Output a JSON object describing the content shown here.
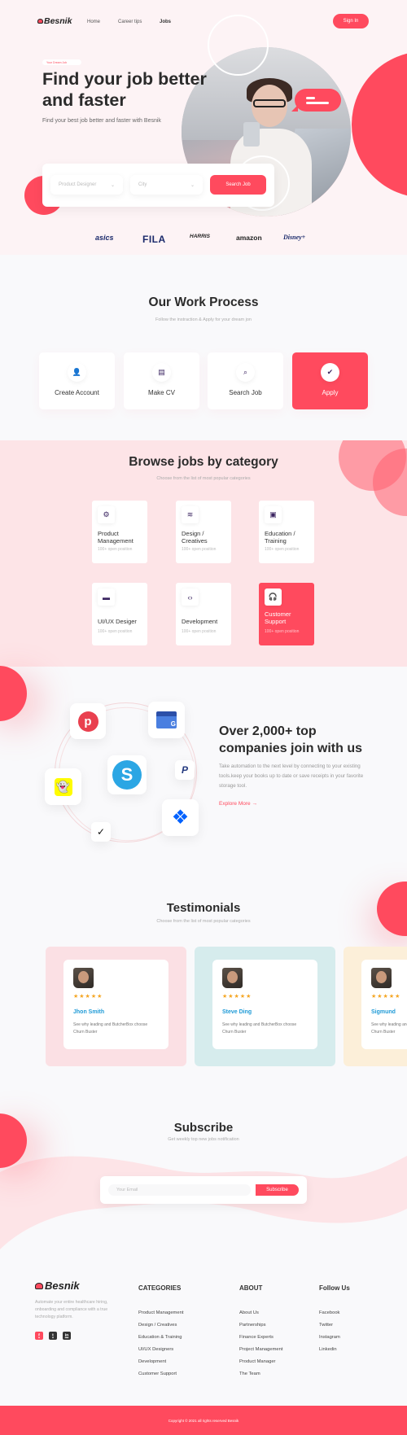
{
  "header": {
    "brand": "Besnik",
    "nav": [
      "Home",
      "Career tips",
      "Jobs"
    ],
    "signin_label": "Sign In"
  },
  "hero": {
    "badge": "Your Dream Job",
    "title": "Find your job better and faster",
    "subtitle": "Find your best job better and faster with Besnik",
    "job_select": "Product Designer",
    "city_select": "City",
    "search_label": "Search Job",
    "brands": [
      "asics",
      "FILA",
      "HARRIS",
      "amazon",
      "Disney+"
    ]
  },
  "process": {
    "title": "Our Work Process",
    "subtitle": "Follow the instraction & Apply for your dream jon",
    "steps": [
      {
        "label": "Create Account",
        "icon": "user-icon"
      },
      {
        "label": "Make CV",
        "icon": "document-icon"
      },
      {
        "label": "Search Job",
        "icon": "search-icon"
      },
      {
        "label": "Apply",
        "icon": "check-circle-icon"
      }
    ]
  },
  "categories": {
    "title": "Browse jobs by category",
    "subtitle": "Choose from the list of most popular categories",
    "items": [
      {
        "name": "Product Management",
        "count": "100+ open position",
        "icon": "gear-icon"
      },
      {
        "name": "Design / Creatives",
        "count": "100+ open position",
        "icon": "layers-icon"
      },
      {
        "name": "Education / Training",
        "count": "100+ open position",
        "icon": "presentation-icon"
      },
      {
        "name": "UI/UX Desiger",
        "count": "100+ open position",
        "icon": "monitor-icon"
      },
      {
        "name": "Development",
        "count": "100+ open position",
        "icon": "code-monitor-icon"
      },
      {
        "name": "Customer Support",
        "count": "100+ open position",
        "icon": "headset-user-icon"
      }
    ]
  },
  "companies": {
    "title": "Over 2,000+ top companies join with us",
    "text": "Take automation to the next level by connecting to your existing tools.keep your books up to date or save receipts in your favorite storage tool.",
    "cta": "Explore More",
    "logos": [
      "Pinterest",
      "Google My Business",
      "Skype",
      "PayPal",
      "Snapchat",
      "Dropbox",
      "Nike"
    ]
  },
  "testimonials": {
    "title": "Testimonials",
    "subtitle": "Choose from the list of most popular categories",
    "items": [
      {
        "name": "Jhon Smith",
        "stars": "★★★★★",
        "text": "See why leading and ButcherBox choose Churn Buster",
        "bg": "#fbe0e4"
      },
      {
        "name": "Steve Ding",
        "stars": "★★★★★",
        "text": "See why leading and ButcherBox choose Churn Buster",
        "bg": "#d6eced"
      },
      {
        "name": "Sigmund",
        "stars": "★★★★★",
        "text": "See why leading and ButcherBox choose Churn Buster",
        "bg": "#fcefd9"
      }
    ]
  },
  "subscribe": {
    "title": "Subscribe",
    "subtitle": "Get weekly top new jobs notification",
    "placeholder": "Your Email",
    "button": "Subscribe"
  },
  "footer": {
    "brand": "Besnik",
    "description": "Automate your entire healthcare hiring, onboarding and compliance with a true technology platform.",
    "social": [
      "f",
      "t",
      "in"
    ],
    "columns": [
      {
        "title": "CATEGORIES",
        "links": [
          "Product Management",
          "Design / Creatives",
          "Education & Training",
          "UI/UX Designers",
          "Development",
          "Customer Support"
        ]
      },
      {
        "title": "ABOUT",
        "links": [
          "About Us",
          "Partnerships",
          "Finance Experts",
          "Project Management",
          "Product Manager",
          "The Team"
        ]
      },
      {
        "title": "Follow Us",
        "links": [
          "Facebook",
          "Twitter",
          "Instagram",
          "Linkedin"
        ]
      }
    ],
    "copyright": "Copyright © 2021 all rights reserved Besnik"
  },
  "colors": {
    "accent": "#ff4a5e",
    "dark": "#2b2b2b",
    "icon": "#3b2561",
    "star": "#f5a623",
    "name": "#1e9ad6"
  }
}
